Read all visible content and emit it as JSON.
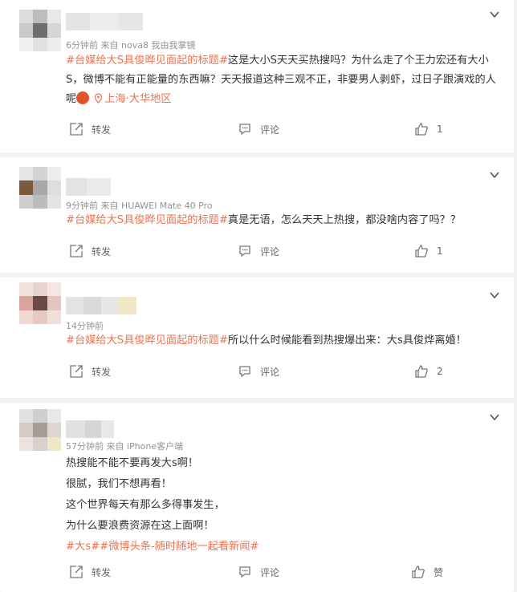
{
  "comments": [
    {
      "meta": "6分钟前  来自 nova8 我由我掌镜",
      "tag": "#台媒给大S具俊晔见面起的标题#",
      "text": "这是大小S天天买热搜吗？为什么走了个王力宏还有大小S，微博不能有正能量的东西嘛？天天报道这种三观不正，非要男人剥虾，过日子跟演戏的人呢",
      "location": "上海·大华地区",
      "repost": "转发",
      "comment": "评论",
      "like": "1"
    },
    {
      "meta": "9分钟前  来自 HUAWEI Mate 40 Pro",
      "tag": "#台媒给大S具俊晔见面起的标题#",
      "text": "真是无语，怎么天天上热搜，都没啥内容了吗？？",
      "repost": "转发",
      "comment": "评论",
      "like": "1"
    },
    {
      "meta": "14分钟前",
      "tag": "#台媒给大S具俊晔见面起的标题#",
      "text": "所以什么时候能看到热搜爆出来：大s具俊烨离婚！",
      "repost": "转发",
      "comment": "评论",
      "like": "2"
    },
    {
      "meta": "57分钟前  来自 iPhone客户端",
      "lines": [
        "热搜能不能不要再发大s啊！",
        "很腻，我们不想再看！",
        "这个世界每天有那么多得事发生，",
        "为什么要浪费资源在这上面啊！"
      ],
      "tags": "#大s##微博头条-随时随地一起看新闻#",
      "repost": "转发",
      "comment": "评论",
      "like": "赞"
    }
  ],
  "colors": {
    "accent": "#eb7350",
    "meta": "#939393",
    "bg": "#f2f2f2"
  }
}
